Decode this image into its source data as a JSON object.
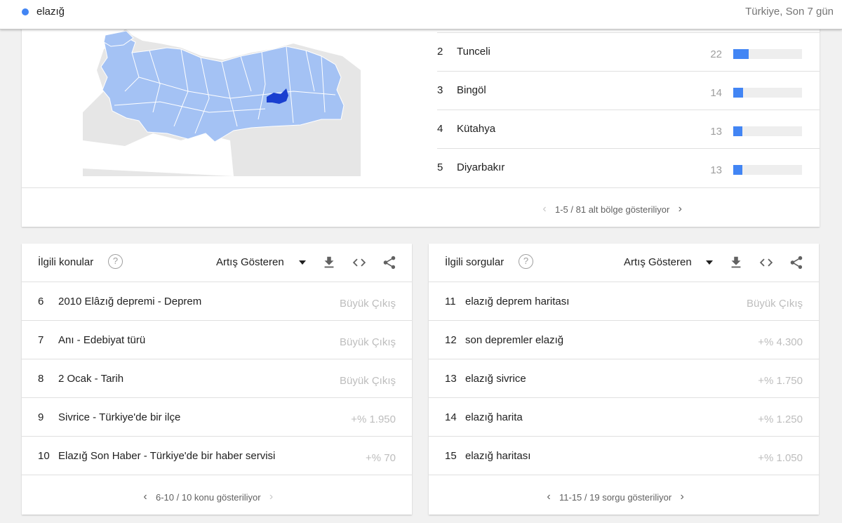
{
  "topbar": {
    "term": "elazığ",
    "scope": "Türkiye, Son 7 gün"
  },
  "colors": {
    "accent": "#4285f4",
    "highlight": "#1a3fd0",
    "map_region": "#a4c2f4",
    "map_sea": "#e6e6e6"
  },
  "regions": {
    "items": [
      {
        "rank": "2",
        "name": "Tunceli",
        "value": "22",
        "fraction": 0.22
      },
      {
        "rank": "3",
        "name": "Bingöl",
        "value": "14",
        "fraction": 0.14
      },
      {
        "rank": "4",
        "name": "Kütahya",
        "value": "13",
        "fraction": 0.13
      },
      {
        "rank": "5",
        "name": "Diyarbakır",
        "value": "13",
        "fraction": 0.13
      }
    ],
    "pager": "1-5 / 81 alt bölge gösteriliyor"
  },
  "topics": {
    "title": "İlgili konular",
    "sort": "Artış Gösteren",
    "items": [
      {
        "rank": "6",
        "label": "2010 Elâzığ depremi - Deprem",
        "metric": "Büyük Çıkış"
      },
      {
        "rank": "7",
        "label": "Anı - Edebiyat türü",
        "metric": "Büyük Çıkış"
      },
      {
        "rank": "8",
        "label": "2 Ocak - Tarih",
        "metric": "Büyük Çıkış"
      },
      {
        "rank": "9",
        "label": "Sivrice - Türkiye'de bir ilçe",
        "metric": "+% 1.950"
      },
      {
        "rank": "10",
        "label": "Elazığ Son Haber - Türkiye'de bir haber servisi",
        "metric": "+% 70"
      }
    ],
    "pager": "6-10 / 10 konu gösteriliyor"
  },
  "queries": {
    "title": "İlgili sorgular",
    "sort": "Artış Gösteren",
    "items": [
      {
        "rank": "11",
        "label": "elazığ deprem haritası",
        "metric": "Büyük Çıkış"
      },
      {
        "rank": "12",
        "label": "son depremler elazığ",
        "metric": "+% 4.300"
      },
      {
        "rank": "13",
        "label": "elazığ sivrice",
        "metric": "+% 1.750"
      },
      {
        "rank": "14",
        "label": "elazığ harita",
        "metric": "+% 1.250"
      },
      {
        "rank": "15",
        "label": "elazığ haritası",
        "metric": "+% 1.050"
      }
    ],
    "pager": "11-15 / 19 sorgu gösteriliyor"
  },
  "icons": {
    "help": "help-circle-icon",
    "download": "download-icon",
    "embed": "embed-code-icon",
    "share": "share-icon",
    "prev": "chevron-left-icon",
    "next": "chevron-right-icon",
    "dropdown": "caret-down-icon"
  }
}
